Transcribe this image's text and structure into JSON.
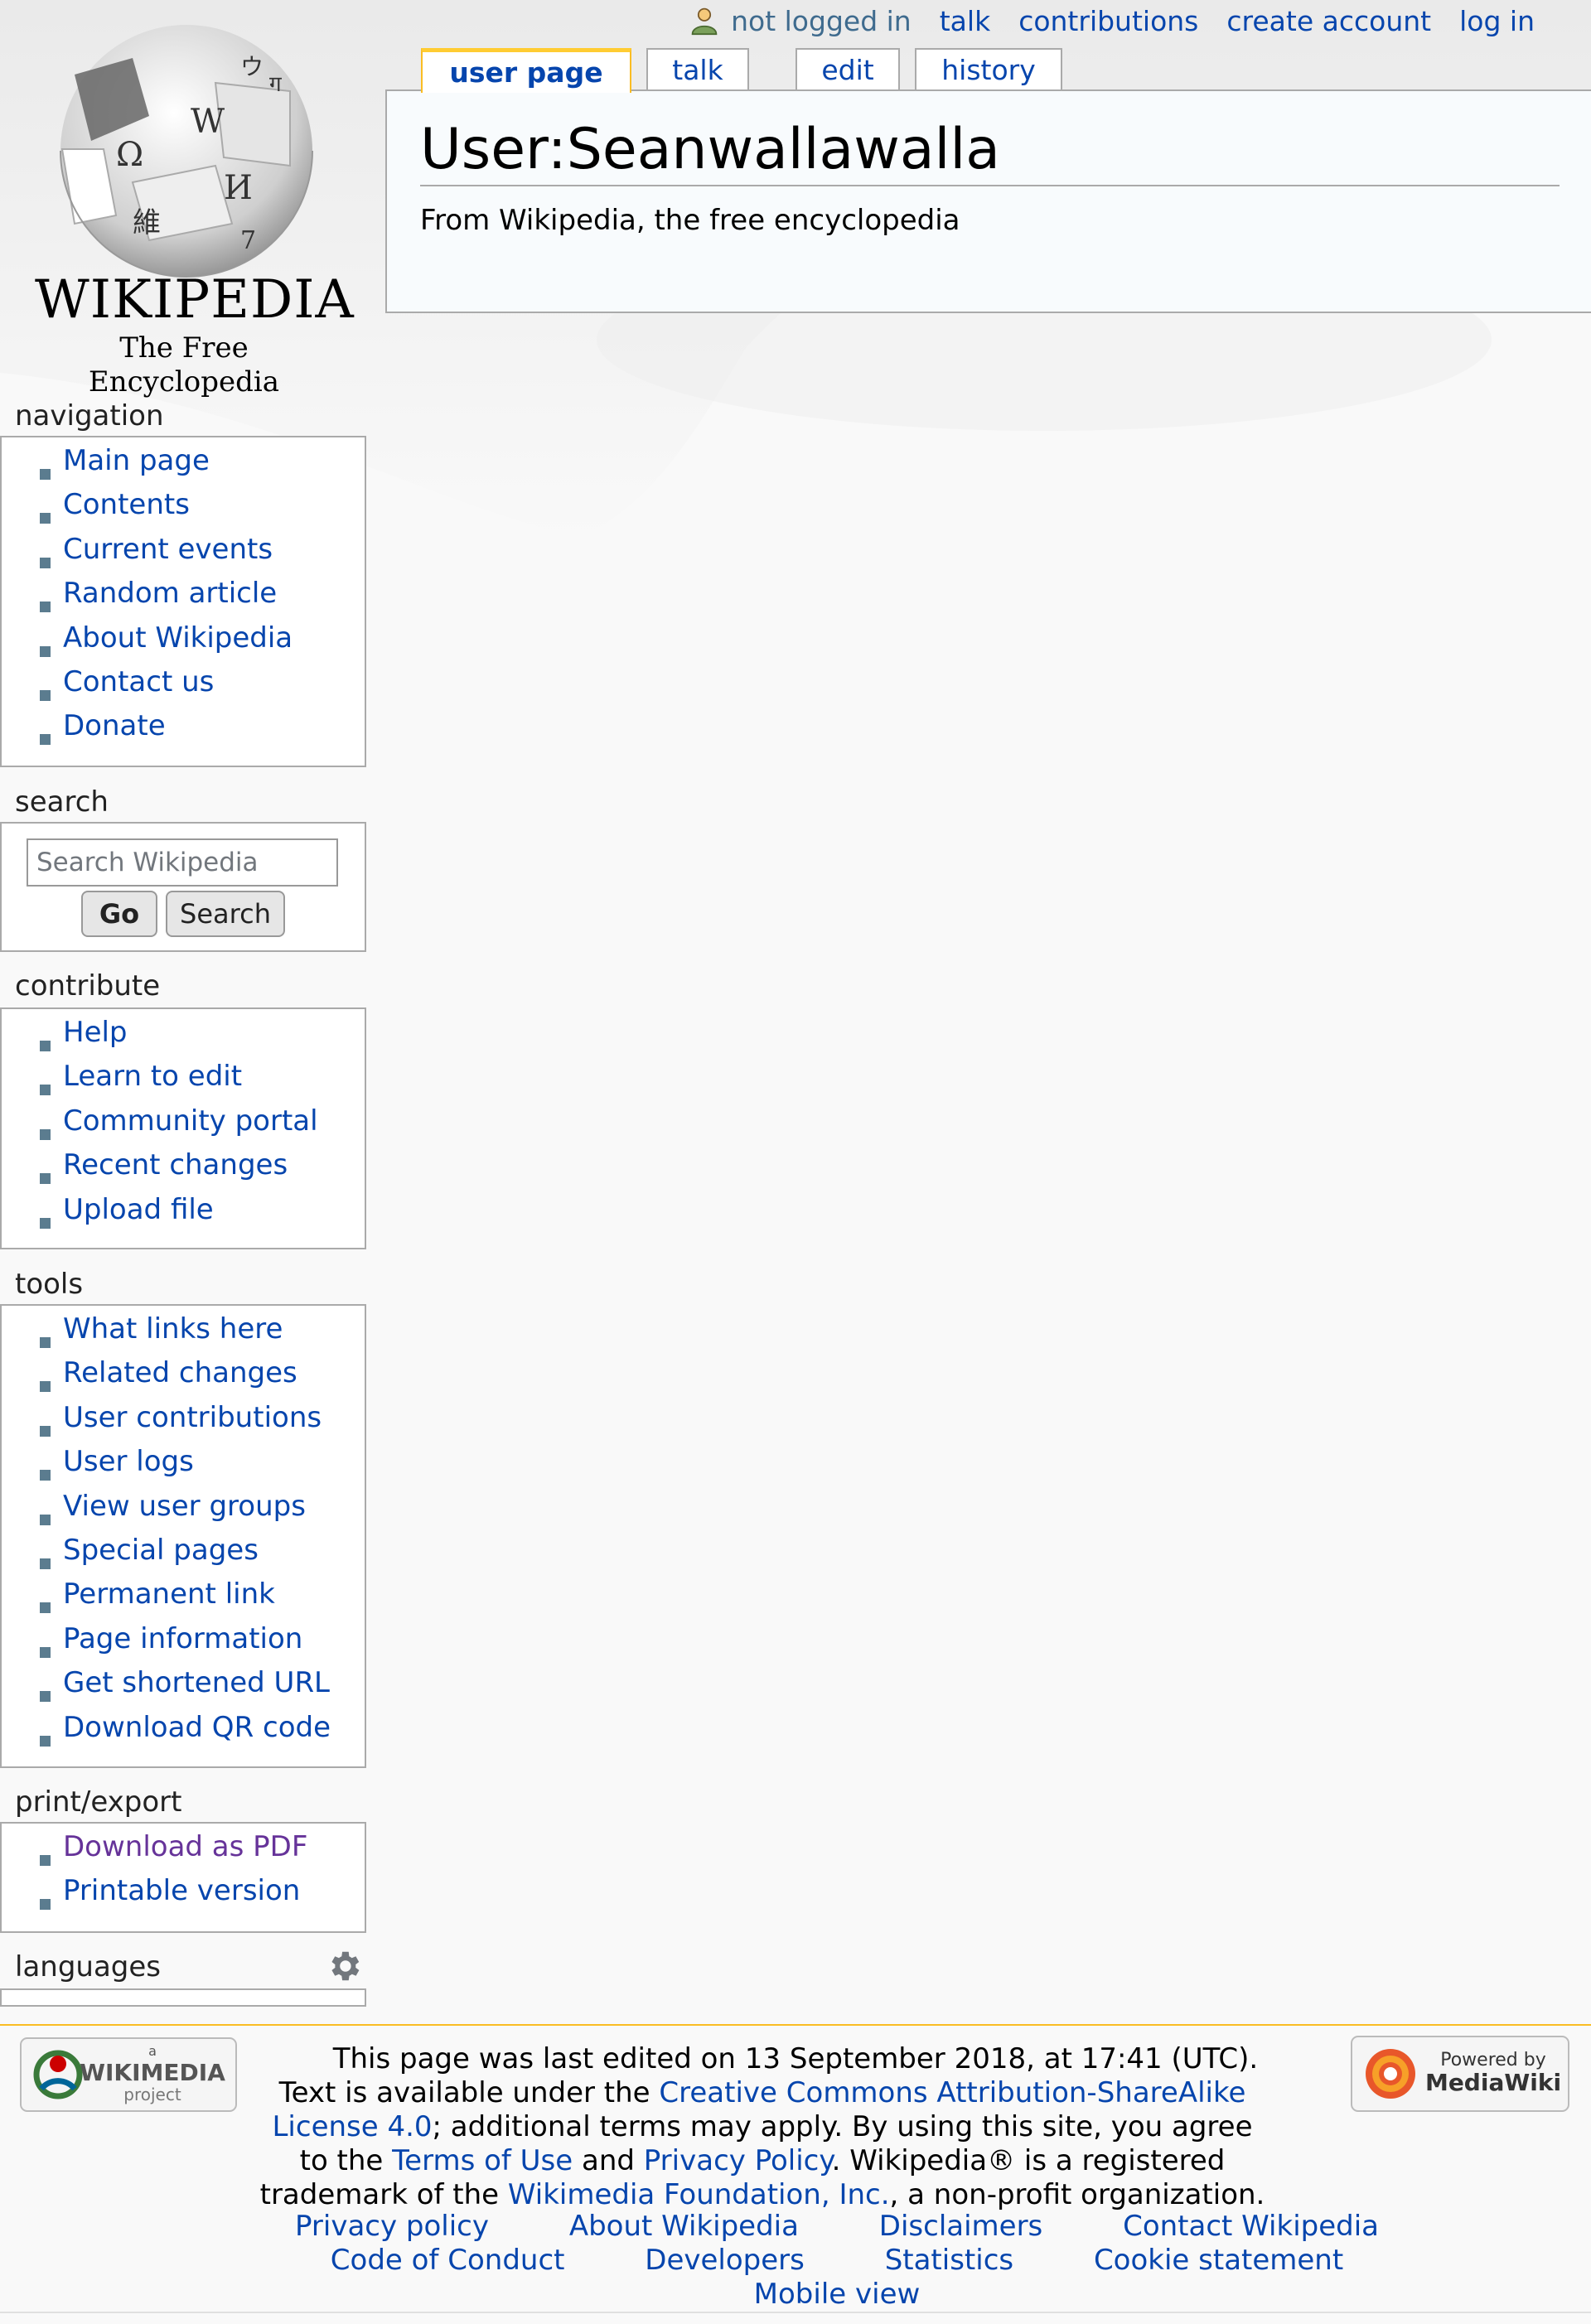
{
  "personal_tools": {
    "not_logged_in": "not logged in",
    "talk": "talk",
    "contributions": "contributions",
    "create_account": "create account",
    "log_in": "log in"
  },
  "tabs": {
    "user_page": "user page",
    "talk": "talk",
    "edit": "edit",
    "history": "history"
  },
  "logo": {
    "wordmark": "WIKIPEDIA",
    "tagline": "The Free Encyclopedia"
  },
  "page": {
    "title": "User:Seanwallawalla",
    "site_sub": "From Wikipedia, the free encyclopedia"
  },
  "sidebar": {
    "navigation": {
      "heading": "navigation",
      "items": [
        "Main page",
        "Contents",
        "Current events",
        "Random article",
        "About Wikipedia",
        "Contact us",
        "Donate"
      ]
    },
    "search": {
      "heading": "search",
      "placeholder": "Search Wikipedia",
      "go_label": "Go",
      "search_label": "Search"
    },
    "contribute": {
      "heading": "contribute",
      "items": [
        "Help",
        "Learn to edit",
        "Community portal",
        "Recent changes",
        "Upload file"
      ]
    },
    "tools": {
      "heading": "tools",
      "items": [
        "What links here",
        "Related changes",
        "User contributions",
        "User logs",
        "View user groups",
        "Special pages",
        "Permanent link",
        "Page information",
        "Get shortened URL",
        "Download QR code"
      ]
    },
    "print_export": {
      "heading": "print/export",
      "items": [
        "Download as PDF",
        "Printable version"
      ]
    },
    "languages": {
      "heading": "languages"
    }
  },
  "footer": {
    "last_edited": "This page was last edited on 13 September 2018, at 17:41 (UTC).",
    "text_available": "Text is available under the ",
    "license_link": "Creative Commons Attribution-ShareAlike License 4.0",
    "additional_terms": "; additional terms may apply. By using this site, you agree to the ",
    "terms_link": "Terms of Use",
    "and": " and ",
    "privacy_link": "Privacy Policy",
    "trademark": ". Wikipedia® is a registered trademark of the ",
    "foundation_link": "Wikimedia Foundation, Inc.",
    "nonprofit": ", a non-profit organization.",
    "links": [
      "Privacy policy",
      "About Wikipedia",
      "Disclaimers",
      "Contact Wikipedia",
      "Code of Conduct",
      "Developers",
      "Statistics",
      "Cookie statement",
      "Mobile view"
    ],
    "wikimedia_badge_small": "a",
    "wikimedia_badge": "WIKIMEDIA",
    "wikimedia_badge_sub": "project",
    "mediawiki_badge_top": "Powered by",
    "mediawiki_badge": "MediaWiki"
  },
  "colors": {
    "link": "#0645ad",
    "visited": "#663399",
    "tab_selected_border": "#fc3",
    "footer_border": "#fabd23"
  }
}
